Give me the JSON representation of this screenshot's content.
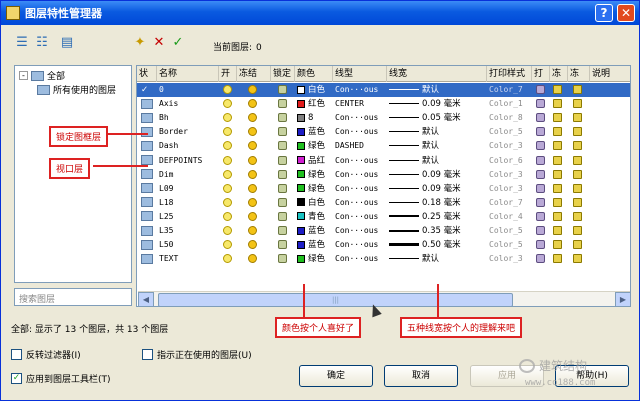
{
  "window": {
    "title": "图层特性管理器",
    "help": "?",
    "close": "✕"
  },
  "toolbar": {
    "current_layer_label": "当前图层:",
    "current_layer_value": "0"
  },
  "tree": {
    "root": "全部",
    "child": "所有使用的图层",
    "toggle": "-"
  },
  "search_placeholder": "搜索图层",
  "columns": [
    "状",
    "名称",
    "开",
    "冻结",
    "锁定",
    "颜色",
    "线型",
    "线宽",
    "打印样式",
    "打",
    "冻",
    "冻",
    "说明"
  ],
  "rows": [
    {
      "name": "0",
      "color_name": "白色",
      "color_hex": "#ffffff",
      "linetype": "Con···ous",
      "lw_label": "默认",
      "lw_unit": "",
      "style": "Color_7",
      "selected": true
    },
    {
      "name": "Axis",
      "color_name": "红色",
      "color_hex": "#e11b1b",
      "linetype": "CENTER",
      "lw_label": "0.09",
      "lw_unit": "毫米",
      "style": "Color_1",
      "selected": false
    },
    {
      "name": "Bh",
      "color_name": "8",
      "color_hex": "#808080",
      "linetype": "Con···ous",
      "lw_label": "0.05",
      "lw_unit": "毫米",
      "style": "Color_8",
      "selected": false
    },
    {
      "name": "Border",
      "color_name": "蓝色",
      "color_hex": "#1d1dc6",
      "linetype": "Con···ous",
      "lw_label": "默认",
      "lw_unit": "",
      "style": "Color_5",
      "selected": false
    },
    {
      "name": "Dash",
      "color_name": "绿色",
      "color_hex": "#1fbf1f",
      "linetype": "DASHED",
      "lw_label": "默认",
      "lw_unit": "",
      "style": "Color_3",
      "selected": false
    },
    {
      "name": "DEFPOINTS",
      "color_name": "品红",
      "color_hex": "#d11fd1",
      "linetype": "Con···ous",
      "lw_label": "默认",
      "lw_unit": "",
      "style": "Color_6",
      "selected": false
    },
    {
      "name": "Dim",
      "color_name": "绿色",
      "color_hex": "#1fbf1f",
      "linetype": "Con···ous",
      "lw_label": "0.09",
      "lw_unit": "毫米",
      "style": "Color_3",
      "selected": false
    },
    {
      "name": "L09",
      "color_name": "绿色",
      "color_hex": "#1fbf1f",
      "linetype": "Con···ous",
      "lw_label": "0.09",
      "lw_unit": "毫米",
      "style": "Color_3",
      "selected": false
    },
    {
      "name": "L18",
      "color_name": "白色",
      "color_hex": "#000000",
      "linetype": "Con···ous",
      "lw_label": "0.18",
      "lw_unit": "毫米",
      "style": "Color_7",
      "selected": false
    },
    {
      "name": "L25",
      "color_name": "青色",
      "color_hex": "#19c3c3",
      "linetype": "Con···ous",
      "lw_label": "0.25",
      "lw_unit": "毫米",
      "style": "Color_4",
      "selected": false
    },
    {
      "name": "L35",
      "color_name": "蓝色",
      "color_hex": "#1d1dc6",
      "linetype": "Con···ous",
      "lw_label": "0.35",
      "lw_unit": "毫米",
      "style": "Color_5",
      "selected": false
    },
    {
      "name": "L50",
      "color_name": "蓝色",
      "color_hex": "#1d1dc6",
      "linetype": "Con···ous",
      "lw_label": "0.50",
      "lw_unit": "毫米",
      "style": "Color_5",
      "selected": false
    },
    {
      "name": "TEXT",
      "color_name": "绿色",
      "color_hex": "#1fbf1f",
      "linetype": "Con···ous",
      "lw_label": "默认",
      "lw_unit": "",
      "style": "Color_3",
      "selected": false
    }
  ],
  "status": "全部: 显示了 13 个图层，共 13 个图层",
  "checkboxes": {
    "invert": {
      "label": "反转过滤器(I)",
      "checked": false
    },
    "indicate": {
      "label": "指示正在使用的图层(U)",
      "checked": false
    },
    "apply": {
      "label": "应用到图层工具栏(T)",
      "checked": true
    }
  },
  "buttons": {
    "ok": "确定",
    "cancel": "取消",
    "apply": "应用",
    "help": "帮助(H)"
  },
  "callouts": {
    "border": "锁定图框层",
    "viewport": "视口层",
    "color": "颜色按个人喜好了",
    "linewidth": "五种线宽按个人的理解来吧"
  },
  "watermark": {
    "text1": "建筑结构",
    "text2": "www.co188.com"
  }
}
